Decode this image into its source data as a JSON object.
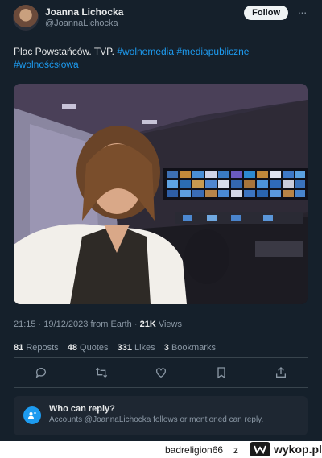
{
  "author": {
    "display_name": "Joanna Lichocka",
    "handle": "@JoannaLichocka"
  },
  "follow_label": "Follow",
  "more_label": "···",
  "tweet": {
    "text": "Plac Powstańców. TVP.",
    "hashtags": [
      "#wolnemedia",
      "#mediapubliczne",
      "#wolnośćsłowa"
    ]
  },
  "meta": {
    "time": "21:15",
    "date": "19/12/2023",
    "source": "from Earth",
    "views_count": "21K",
    "views_label": "Views"
  },
  "stats": {
    "reposts_count": "81",
    "reposts_label": "Reposts",
    "quotes_count": "48",
    "quotes_label": "Quotes",
    "likes_count": "331",
    "likes_label": "Likes",
    "bookmarks_count": "3",
    "bookmarks_label": "Bookmarks"
  },
  "actions": [
    "reply-icon",
    "repost-icon",
    "like-icon",
    "bookmark-icon",
    "share-icon"
  ],
  "reply_settings": {
    "title": "Who can reply?",
    "description": "Accounts @JoannaLichocka follows or mentioned can reply."
  },
  "footer": {
    "username": "badreligion66",
    "separator": "z",
    "site": "wykop.pl"
  },
  "colors": {
    "background": "#15202b",
    "accent": "#1d9bf0",
    "text": "#e7e9ea",
    "muted": "#8b98a5"
  }
}
